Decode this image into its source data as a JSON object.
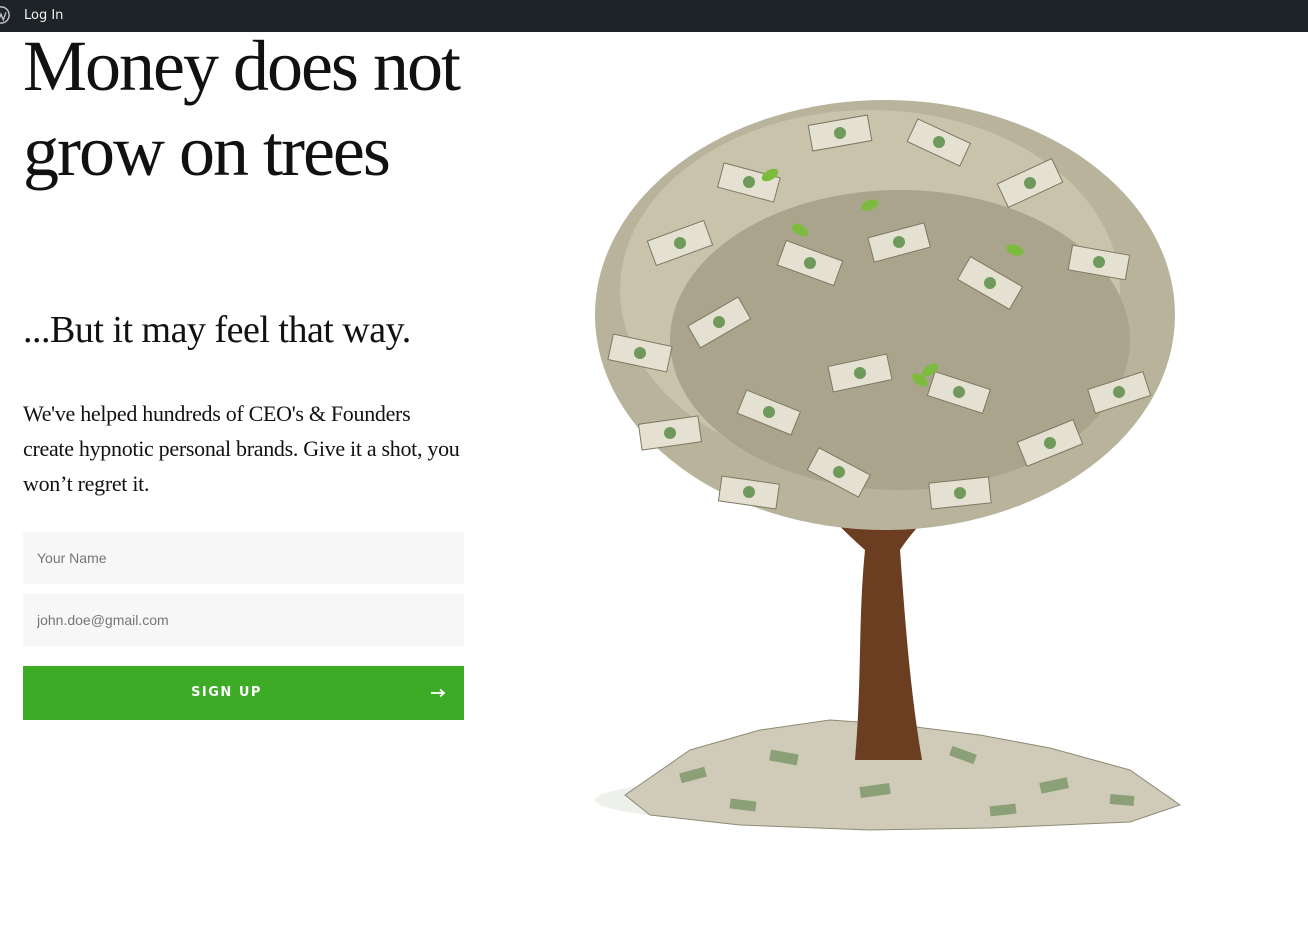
{
  "adminbar": {
    "wp_icon": "wordpress-icon",
    "login_label": "Log In"
  },
  "hero": {
    "headline": "Money does not grow on trees",
    "subheadline": "...But it may feel that way.",
    "body": "We've helped hundreds of CEO's & Founders create hypnotic personal brands. Give it a shot, you won’t regret it."
  },
  "form": {
    "name_placeholder": "Your Name",
    "email_placeholder": "john.doe@gmail.com",
    "submit_label": "SIGN UP",
    "submit_icon": "arrow-right-icon",
    "button_color": "#3dab25"
  },
  "image": {
    "subject": "money-tree-illustration"
  },
  "colors": {
    "adminbar_bg": "#1d2327",
    "text": "#111111",
    "input_bg": "#f7f7f7",
    "accent": "#3dab25"
  }
}
